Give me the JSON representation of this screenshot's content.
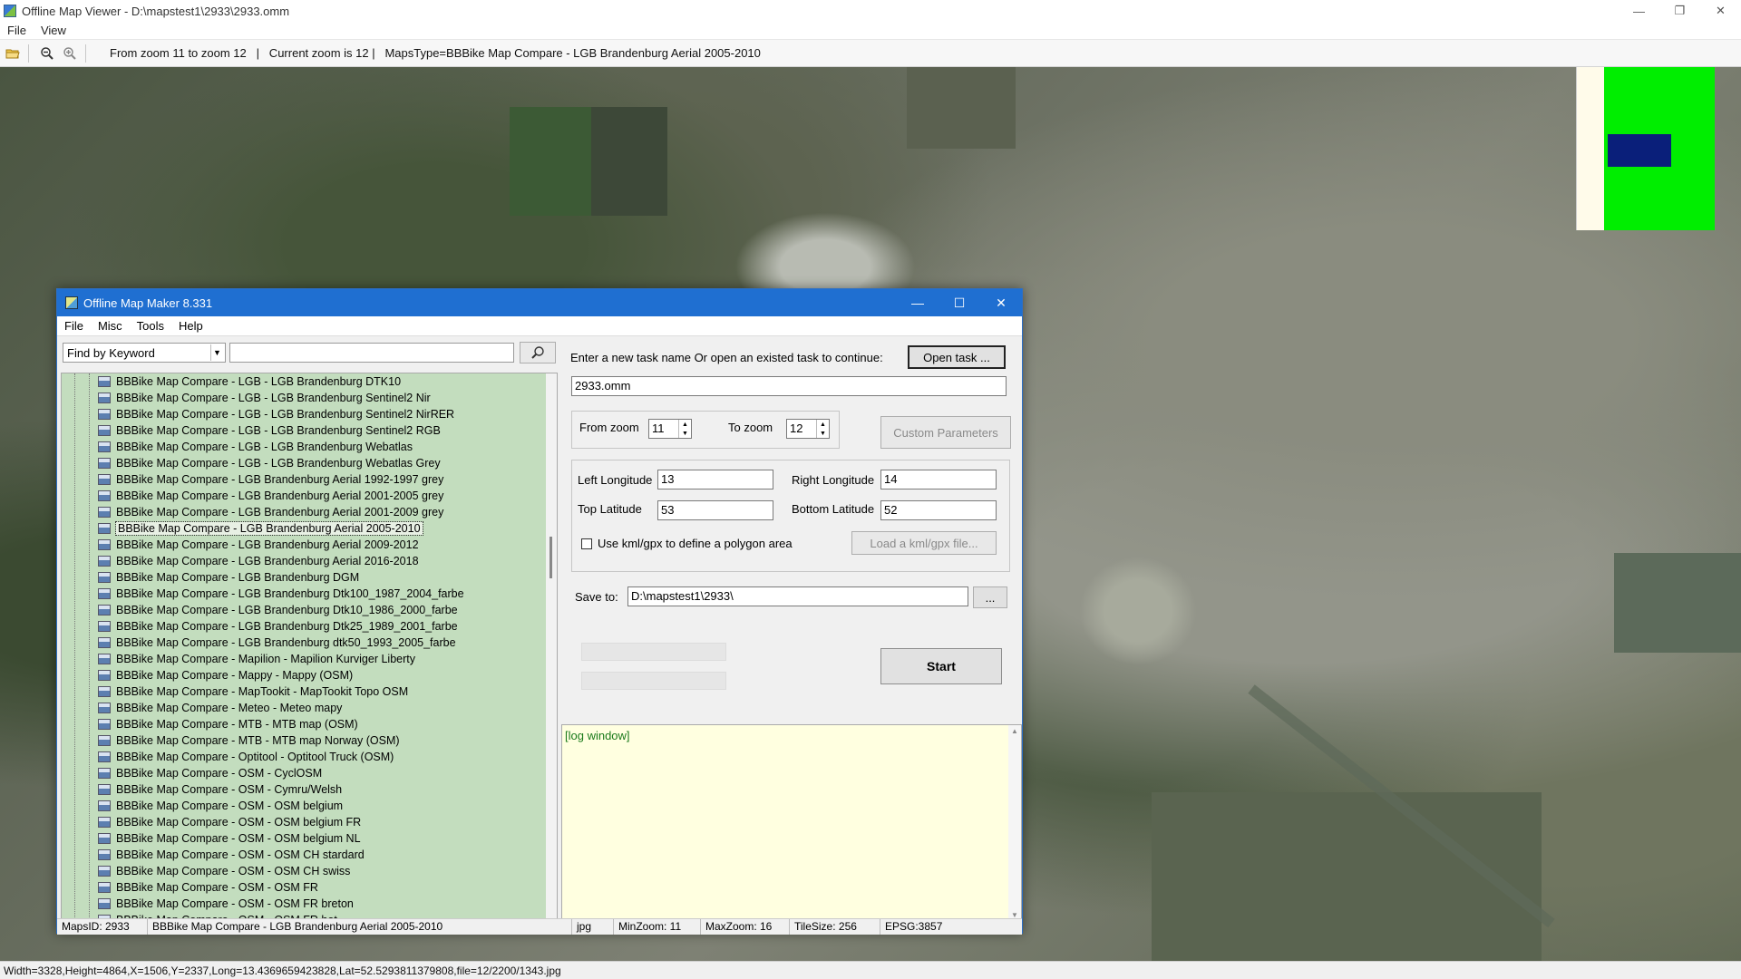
{
  "viewer": {
    "title": "Offline Map Viewer - D:\\mapstest1\\2933\\2933.omm",
    "menu": [
      "File",
      "View"
    ],
    "toolbar_info": "From zoom 11 to zoom 12   |   Current zoom is 12 |   MapsType=BBBike Map Compare - LGB Brandenburg Aerial 2005-2010",
    "status": "Width=3328,Height=4864,X=1506,Y=2337,Long=13.4369659423828,Lat=52.5293811379808,file=12/2200/1343.jpg",
    "icons": [
      "open-folder-icon",
      "zoom-out-icon",
      "zoom-in-icon"
    ]
  },
  "maker": {
    "title": "Offline Map Maker 8.331",
    "menu": [
      "File",
      "Misc",
      "Tools",
      "Help"
    ],
    "search": {
      "mode": "Find by Keyword",
      "value": ""
    },
    "tree_items": [
      "BBBike Map Compare - LGB - LGB Brandenburg DTK10",
      "BBBike Map Compare - LGB - LGB Brandenburg Sentinel2 Nir",
      "BBBike Map Compare - LGB - LGB Brandenburg Sentinel2 NirRER",
      "BBBike Map Compare - LGB - LGB Brandenburg Sentinel2 RGB",
      "BBBike Map Compare - LGB - LGB Brandenburg Webatlas",
      "BBBike Map Compare - LGB - LGB Brandenburg Webatlas Grey",
      "BBBike Map Compare - LGB Brandenburg Aerial 1992-1997 grey",
      "BBBike Map Compare - LGB Brandenburg Aerial 2001-2005 grey",
      "BBBike Map Compare - LGB Brandenburg Aerial 2001-2009 grey",
      "BBBike Map Compare - LGB Brandenburg Aerial 2005-2010",
      "BBBike Map Compare - LGB Brandenburg Aerial 2009-2012",
      "BBBike Map Compare - LGB Brandenburg Aerial 2016-2018",
      "BBBike Map Compare - LGB Brandenburg DGM",
      "BBBike Map Compare - LGB Brandenburg Dtk100_1987_2004_farbe",
      "BBBike Map Compare - LGB Brandenburg Dtk10_1986_2000_farbe",
      "BBBike Map Compare - LGB Brandenburg Dtk25_1989_2001_farbe",
      "BBBike Map Compare - LGB Brandenburg dtk50_1993_2005_farbe",
      "BBBike Map Compare - Mapilion - Mapilion Kurviger Liberty",
      "BBBike Map Compare - Mappy - Mappy (OSM)",
      "BBBike Map Compare - MapTookit - MapTookit Topo OSM",
      "BBBike Map Compare - Meteo - Meteo mapy",
      "BBBike Map Compare - MTB - MTB map (OSM)",
      "BBBike Map Compare - MTB - MTB map Norway (OSM)",
      "BBBike Map Compare - Optitool - Optitool Truck (OSM)",
      "BBBike Map Compare - OSM - CyclOSM",
      "BBBike Map Compare - OSM - Cymru/Welsh",
      "BBBike Map Compare - OSM - OSM belgium",
      "BBBike Map Compare - OSM - OSM belgium FR",
      "BBBike Map Compare - OSM - OSM belgium NL",
      "BBBike Map Compare - OSM - OSM CH stardard",
      "BBBike Map Compare - OSM - OSM CH swiss",
      "BBBike Map Compare - OSM - OSM FR",
      "BBBike Map Compare - OSM - OSM FR breton",
      "BBBike Map Compare - OSM - OSM FR hot"
    ],
    "selected_index": 9,
    "task_prompt": "Enter a new task name Or open an existed task to continue:",
    "open_task_label": "Open task ...",
    "task_name": "2933.omm",
    "from_zoom_label": "From zoom",
    "from_zoom": "11",
    "to_zoom_label": "To zoom",
    "to_zoom": "12",
    "custom_params_label": "Custom Parameters",
    "left_lon_label": "Left Longitude",
    "left_lon": "13",
    "right_lon_label": "Right Longitude",
    "right_lon": "14",
    "top_lat_label": "Top Latitude",
    "top_lat": "53",
    "bottom_lat_label": "Bottom Latitude",
    "bottom_lat": "52",
    "kml_label": "Use kml/gpx to define a polygon area",
    "load_kml_label": "Load a kml/gpx file...",
    "save_to_label": "Save to:",
    "save_to": "D:\\mapstest1\\2933\\",
    "browse_label": "...",
    "start_label": "Start",
    "log_text": "[log window]",
    "status": {
      "maps_id": "MapsID: 2933",
      "map_name": "BBBike Map Compare - LGB Brandenburg Aerial 2005-2010",
      "format": "jpg",
      "min_zoom": "MinZoom: 11",
      "max_zoom": "MaxZoom: 16",
      "tile_size": "TileSize: 256",
      "epsg": "EPSG:3857"
    }
  }
}
